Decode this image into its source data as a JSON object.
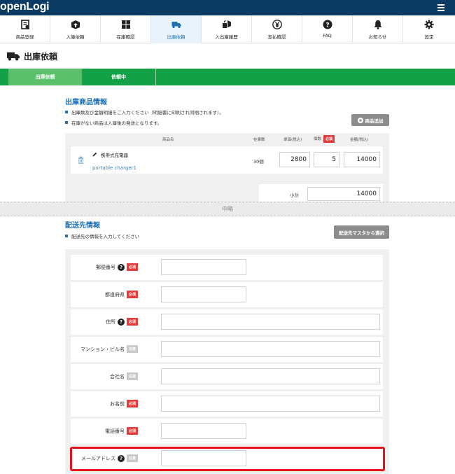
{
  "header": {
    "logo_text": "openLogi",
    "menu_icon": "list-icon"
  },
  "nav": [
    {
      "label": "商品登録",
      "icon": "product-register-icon"
    },
    {
      "label": "入庫依頼",
      "icon": "box-arrow-icon"
    },
    {
      "label": "在庫確認",
      "icon": "boxes-icon"
    },
    {
      "label": "出庫依頼",
      "icon": "truck-icon",
      "active": true
    },
    {
      "label": "入出庫履歴",
      "icon": "history-icon"
    },
    {
      "label": "支払確認",
      "icon": "yen-icon"
    },
    {
      "label": "FAQ",
      "icon": "question-icon"
    },
    {
      "label": "お知らせ",
      "icon": "bell-icon"
    },
    {
      "label": "設定",
      "icon": "gear-icon"
    }
  ],
  "page": {
    "title": "出庫依頼"
  },
  "steps": {
    "step1": "出庫依頼",
    "step2": "依頼中"
  },
  "products_section": {
    "title": "出庫商品情報",
    "note1": "出庫数及び金額明細をご入力ください（明細書に印刷され同梱されます）。",
    "note2": "在庫がない商品は入庫後の発送になります。",
    "add_button": "商品追加",
    "headers": {
      "name": "商品名",
      "stock": "在庫数",
      "unit_price": "単価(税込)",
      "qty": "個数",
      "required": "必須",
      "amount": "金額(税込)"
    },
    "rows": [
      {
        "name": "携帯式充電器",
        "code": "portable charger1",
        "stock": "30個",
        "unit_price": "2800",
        "qty": "5",
        "amount": "14000"
      }
    ],
    "subtotal_label": "小計",
    "subtotal_value": "14000"
  },
  "omitted_label": "中略",
  "delivery_section": {
    "title": "配送先情報",
    "note": "配送先の情報を入力してください",
    "master_button": "配送先マスタから選択",
    "fields": [
      {
        "label": "郵便番号",
        "help": true,
        "badge": "必須",
        "required": true
      },
      {
        "label": "都道府県",
        "help": false,
        "badge": "必須",
        "required": true
      },
      {
        "label": "住所",
        "help": true,
        "badge": "必須",
        "required": true
      },
      {
        "label": "マンション・ビル名",
        "help": false,
        "badge": "任意",
        "required": false
      },
      {
        "label": "会社名",
        "help": false,
        "badge": "任意",
        "required": false
      },
      {
        "label": "お名前",
        "help": false,
        "badge": "必須",
        "required": true
      },
      {
        "label": "電話番号",
        "help": false,
        "badge": "必須",
        "required": true
      },
      {
        "label": "メールアドレス",
        "help": true,
        "badge": "任意",
        "required": false
      }
    ]
  },
  "colors": {
    "header_bg": "#0b3a63",
    "accent_blue": "#1d6fb4",
    "step_green": "#14a046",
    "step_active": "#5bbf6c",
    "required_red": "#e63b3b",
    "highlight_red": "#e3141b"
  }
}
